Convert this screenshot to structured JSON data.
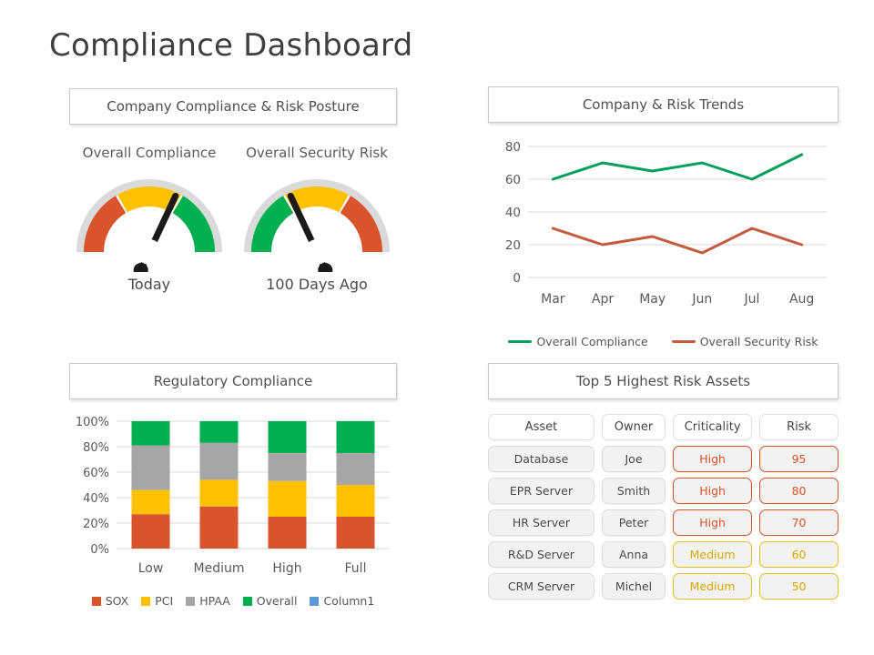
{
  "page": {
    "title": "Compliance Dashboard"
  },
  "panels": {
    "posture": {
      "header": "Company Compliance & Risk Posture"
    },
    "trends": {
      "header": "Company & Risk Trends"
    },
    "regulatory": {
      "header": "Regulatory Compliance"
    },
    "assets": {
      "header": "Top 5 Highest Risk Assets"
    }
  },
  "gauges": [
    {
      "title": "Overall Compliance",
      "footer": "Today",
      "needle_deg": 65,
      "order": "red-yellow-green"
    },
    {
      "title": "Overall Security Risk",
      "footer": "100 Days Ago",
      "needle_deg": 115,
      "order": "green-yellow-red"
    }
  ],
  "colors": {
    "red": "#D9532C",
    "yellow": "#FFC000",
    "green": "#00B050",
    "gray": "#A6A6A6",
    "blue": "#5B9BD5",
    "arc_track": "#D4D4D4",
    "needle": "#1a1a1a",
    "grid": "#D9D9D9"
  },
  "chart_data": [
    {
      "type": "line",
      "title": "Company & Risk Trends",
      "categories": [
        "Mar",
        "Apr",
        "May",
        "Jun",
        "Jul",
        "Aug"
      ],
      "series": [
        {
          "name": "Overall Compliance",
          "color": "#00A15C",
          "values": [
            60,
            70,
            65,
            70,
            60,
            75
          ]
        },
        {
          "name": "Overall Security Risk",
          "color": "#C55A3C",
          "values": [
            30,
            20,
            25,
            15,
            30,
            20
          ]
        }
      ],
      "yticks": [
        0,
        20,
        40,
        60,
        80
      ],
      "ylim": [
        0,
        80
      ],
      "xlabel": "",
      "ylabel": "",
      "grid": true,
      "legend_position": "bottom"
    },
    {
      "type": "bar",
      "stacked": true,
      "title": "Regulatory Compliance",
      "categories": [
        "Low",
        "Medium",
        "High",
        "Full"
      ],
      "series": [
        {
          "name": "SOX",
          "color": "#D9532C",
          "values": [
            27,
            33,
            25,
            25
          ]
        },
        {
          "name": "PCI",
          "color": "#FFC000",
          "values": [
            19,
            21,
            28,
            25
          ]
        },
        {
          "name": "HPAA",
          "color": "#A6A6A6",
          "values": [
            35,
            29,
            22,
            25
          ]
        },
        {
          "name": "Overall",
          "color": "#00B050",
          "values": [
            19,
            17,
            25,
            25
          ]
        },
        {
          "name": "Column1",
          "color": "#5B9BD5",
          "values": [
            0,
            0,
            0,
            0
          ]
        }
      ],
      "yticks": [
        "0%",
        "20%",
        "40%",
        "60%",
        "80%",
        "100%"
      ],
      "ylim": [
        0,
        100
      ],
      "xlabel": "",
      "ylabel": "",
      "grid": true,
      "legend_position": "bottom"
    }
  ],
  "assets_table": {
    "columns": [
      "Asset",
      "Owner",
      "Criticality",
      "Risk"
    ],
    "rows": [
      {
        "asset": "Database",
        "owner": "Joe",
        "criticality": "High",
        "risk": "95",
        "level": "high"
      },
      {
        "asset": "EPR Server",
        "owner": "Smith",
        "criticality": "High",
        "risk": "80",
        "level": "high"
      },
      {
        "asset": "HR Server",
        "owner": "Peter",
        "criticality": "High",
        "risk": "70",
        "level": "high"
      },
      {
        "asset": "R&D Server",
        "owner": "Anna",
        "criticality": "Medium",
        "risk": "60",
        "level": "medium"
      },
      {
        "asset": "CRM Server",
        "owner": "Michel",
        "criticality": "Medium",
        "risk": "50",
        "level": "medium"
      }
    ]
  }
}
